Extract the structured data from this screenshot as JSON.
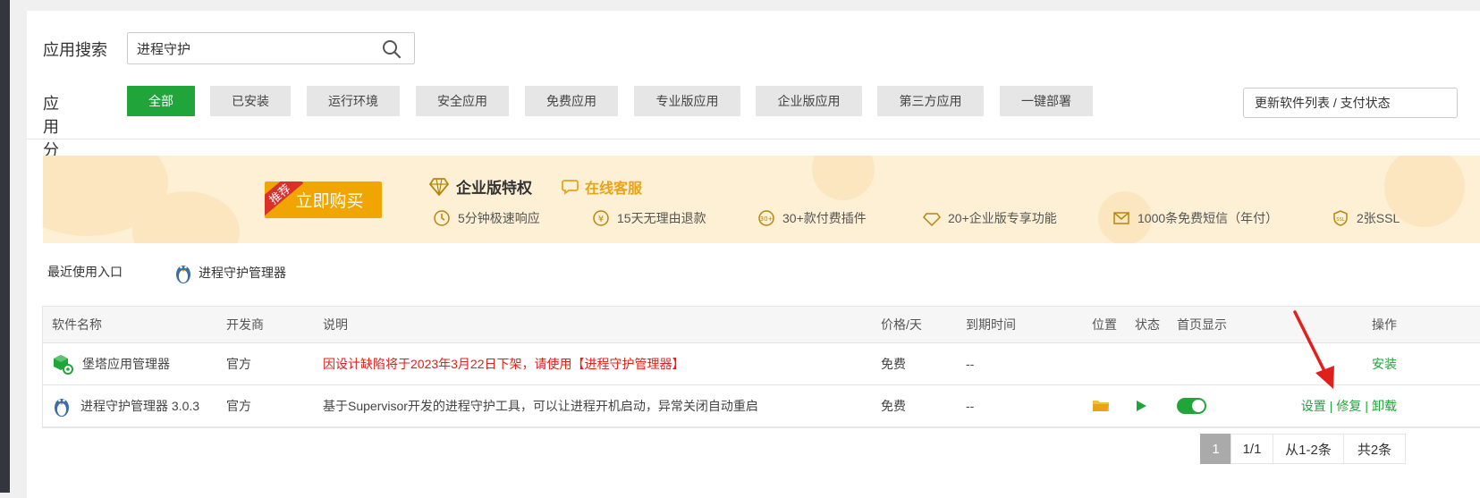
{
  "search": {
    "label": "应用搜索",
    "value": "进程守护"
  },
  "categories": {
    "label": "应用分类",
    "items": [
      "全部",
      "已安装",
      "运行环境",
      "安全应用",
      "免费应用",
      "专业版应用",
      "企业版应用",
      "第三方应用",
      "一键部署"
    ],
    "refresh_label": "更新软件列表 / 支付状态"
  },
  "banner": {
    "tag": "推荐",
    "buy_label": "立即购买",
    "enterprise_title": "企业版特权",
    "service_label": "在线客服",
    "features": [
      "5分钟极速响应",
      "15天无理由退款",
      "30+款付费插件",
      "20+企业版专享功能",
      "1000条免费短信（年付）",
      "2张SSL"
    ]
  },
  "recent": {
    "label": "最近使用入口",
    "item": "进程守护管理器"
  },
  "table": {
    "headers": {
      "name": "软件名称",
      "dev": "开发商",
      "desc": "说明",
      "price": "价格/天",
      "expire": "到期时间",
      "position": "位置",
      "state": "状态",
      "home": "首页显示",
      "ops": "操作"
    },
    "rows": [
      {
        "name": "堡塔应用管理器",
        "dev": "官方",
        "desc": "因设计缺陷将于2023年3月22日下架，请使用【进程守护管理器】",
        "price": "免费",
        "expire": "--",
        "op": "安装"
      },
      {
        "name": "进程守护管理器 3.0.3",
        "dev": "官方",
        "desc": "基于Supervisor开发的进程守护工具，可以让进程开机启动，异常关闭自动重启",
        "price": "免费",
        "expire": "--",
        "op_settings": "设置",
        "op_repair": "修复",
        "op_uninstall": "卸载",
        "sep": "|",
        "home_display": true
      }
    ]
  },
  "pagination": {
    "current": "1",
    "pages": "1/1",
    "range": "从1-2条",
    "total": "共2条"
  },
  "colors": {
    "accent": "#20a53a",
    "warning": "#e0201b",
    "gold": "#f0a500"
  }
}
